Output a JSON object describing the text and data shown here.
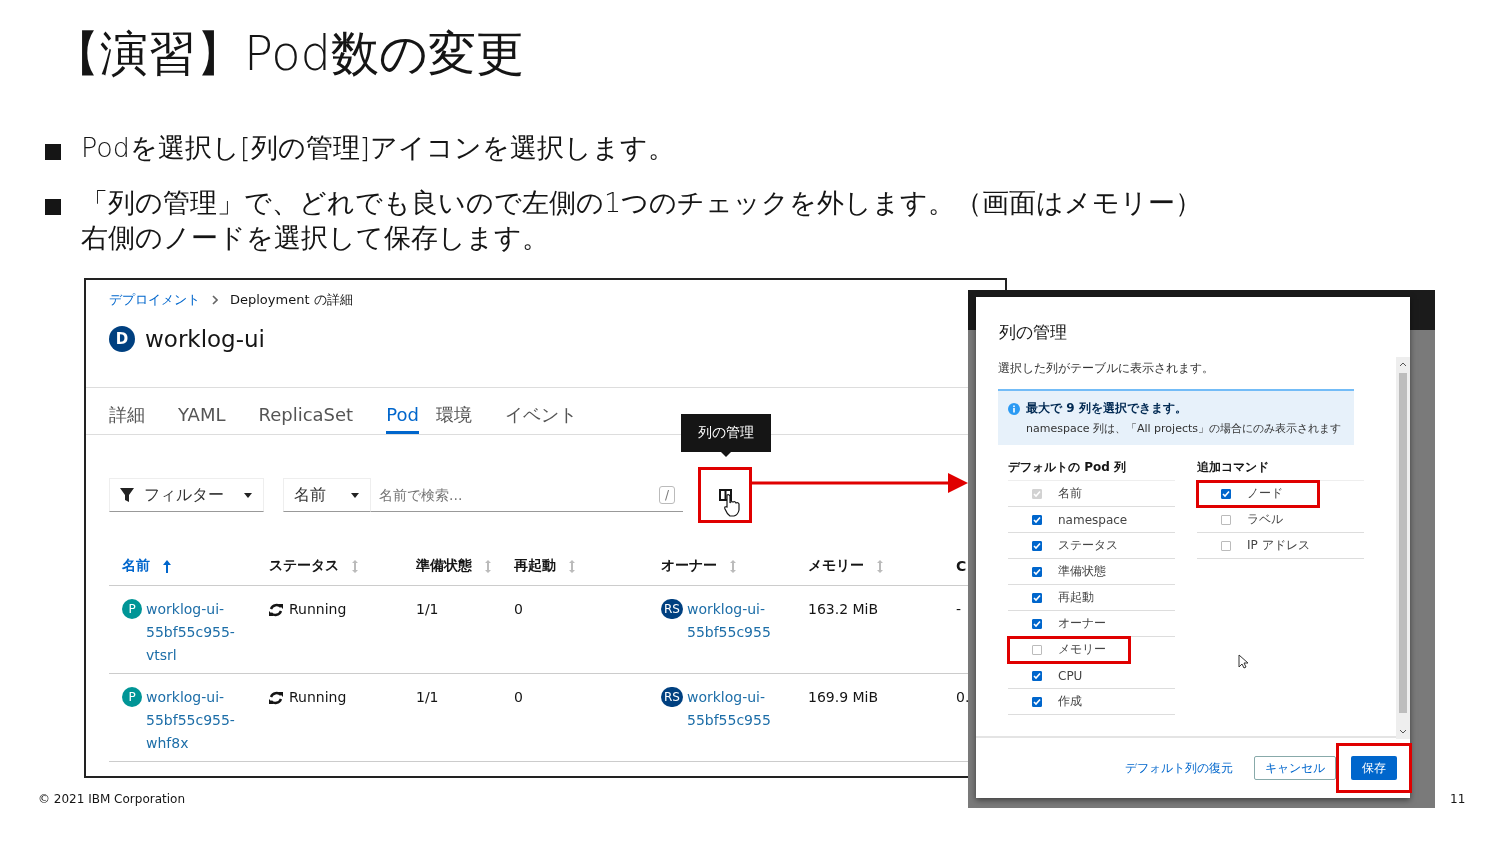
{
  "slide": {
    "title": "【演習】Pod数の変更",
    "bullets": [
      {
        "lines": [
          "Podを選択し[列の管理]アイコンを選択します。"
        ]
      },
      {
        "lines": [
          "「列の管理」で、どれでも良いので左側の1つのチェックを外します。（画面はメモリー）",
          "右側のノードを選択して保存します。"
        ]
      }
    ],
    "footer": "© 2021 IBM Corporation",
    "page_number": "11"
  },
  "console": {
    "breadcrumb": [
      {
        "label": "デプロイメント",
        "link": true
      },
      {
        "label": "Deployment の詳細",
        "link": false
      }
    ],
    "resource": {
      "badge": "D",
      "name": "worklog-ui"
    },
    "tabs": [
      {
        "label": "詳細",
        "selected": false
      },
      {
        "label": "YAML",
        "selected": false
      },
      {
        "label": "ReplicaSet",
        "selected": false
      },
      {
        "label": "Pod",
        "selected": true
      },
      {
        "label": "環境",
        "selected": false
      },
      {
        "label": "イベント",
        "selected": false
      }
    ],
    "filter": {
      "label": "フィルター"
    },
    "search_by": "名前",
    "search": {
      "placeholder": "名前で検索...",
      "shortcut": "/"
    },
    "column_button": {
      "highlighted": true,
      "tooltip": "列の管理"
    },
    "table": {
      "columns": [
        {
          "label": "名前",
          "sorted": true
        },
        {
          "label": "ステータス",
          "sorted": false
        },
        {
          "label": "準備状態",
          "sorted": false
        },
        {
          "label": "再起動",
          "sorted": false
        },
        {
          "label": "オーナー",
          "sorted": false
        },
        {
          "label": "メモリー",
          "sorted": false
        },
        {
          "label": "C"
        }
      ],
      "rows": [
        {
          "badge": "P",
          "name": "worklog-ui-55bf55c955-vtsrl",
          "status": "Running",
          "ready": "1/1",
          "restarts": "0",
          "owner_badge": "RS",
          "owner": "worklog-ui-55bf55c955",
          "memory": "163.2 MiB",
          "column_7": "-"
        },
        {
          "badge": "P",
          "name": "worklog-ui-55bf55c955-whf8x",
          "status": "Running",
          "ready": "1/1",
          "restarts": "0",
          "owner_badge": "RS",
          "owner": "worklog-ui-55bf55c955",
          "memory": "169.9 MiB",
          "column_7": "0."
        }
      ]
    }
  },
  "dialog": {
    "title": "列の管理",
    "description": "選択した列がテーブルに表示されます。",
    "alert": {
      "title": "最大で 9 列を選択できます。",
      "text": "namespace 列は、「All projects」の場合にのみ表示されます"
    },
    "groups": [
      {
        "heading": "デフォルトの Pod 列",
        "items": [
          {
            "label": "名前",
            "checked": true,
            "disabled": true,
            "highlighted": false
          },
          {
            "label": "namespace",
            "checked": true,
            "disabled": false,
            "highlighted": false
          },
          {
            "label": "ステータス",
            "checked": true,
            "disabled": false,
            "highlighted": false
          },
          {
            "label": "準備状態",
            "checked": true,
            "disabled": false,
            "highlighted": false
          },
          {
            "label": "再起動",
            "checked": true,
            "disabled": false,
            "highlighted": false
          },
          {
            "label": "オーナー",
            "checked": true,
            "disabled": false,
            "highlighted": false
          },
          {
            "label": "メモリー",
            "checked": false,
            "disabled": false,
            "highlighted": true
          },
          {
            "label": "CPU",
            "checked": true,
            "disabled": false,
            "highlighted": false
          },
          {
            "label": "作成",
            "checked": true,
            "disabled": false,
            "highlighted": false
          }
        ]
      },
      {
        "heading": "追加コマンド",
        "items": [
          {
            "label": "ノード",
            "checked": true,
            "disabled": false,
            "highlighted": true
          },
          {
            "label": "ラベル",
            "checked": false,
            "disabled": false,
            "highlighted": false
          },
          {
            "label": "IP アドレス",
            "checked": false,
            "disabled": false,
            "highlighted": false
          }
        ]
      }
    ],
    "buttons": [
      {
        "label": "デフォルト列の復元",
        "kind": "link",
        "highlighted": false
      },
      {
        "label": "キャンセル",
        "kind": "secondary",
        "highlighted": false
      },
      {
        "label": "保存",
        "kind": "primary",
        "highlighted": true
      }
    ]
  }
}
